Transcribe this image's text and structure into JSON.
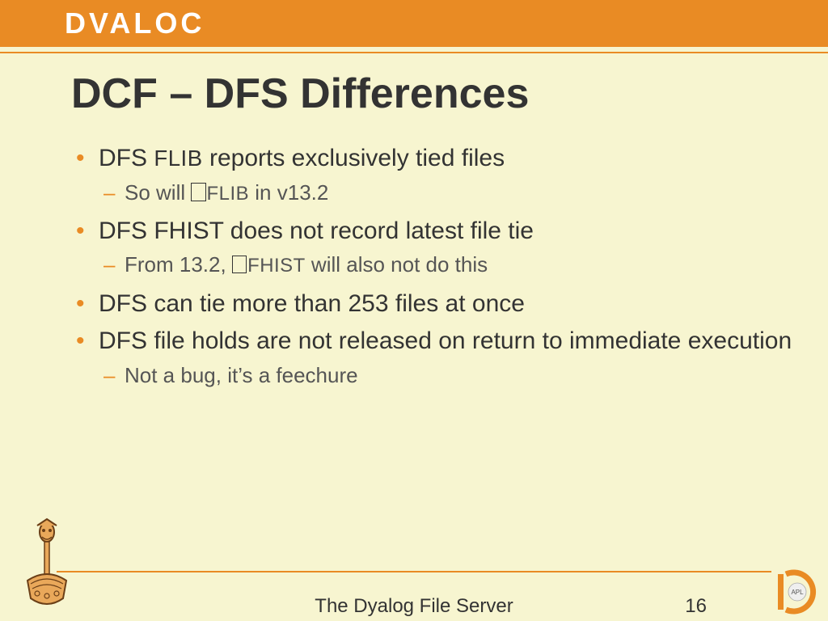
{
  "brand": {
    "logo": "DVALOC"
  },
  "title": "DCF – DFS Differences",
  "bullets": {
    "b1_pre": "DFS ",
    "b1_mid": "FLIB",
    "b1_post": " reports exclusively tied files",
    "b1_sub_pre": "So will ",
    "b1_sub_mid": "FLIB",
    "b1_sub_post": " in v13.2",
    "b2": "DFS FHIST does not record latest file tie",
    "b2_sub_pre": "From 13.2, ",
    "b2_sub_mid": "FHIST",
    "b2_sub_post": " will also not do this",
    "b3": "DFS can tie more than 253 files at once",
    "b4": "DFS file holds are not released on return to immediate execution",
    "b4_sub": "Not a bug, it’s a feechure"
  },
  "footer": {
    "title": "The Dyalog File Server",
    "page": "16",
    "apl": "APL"
  }
}
